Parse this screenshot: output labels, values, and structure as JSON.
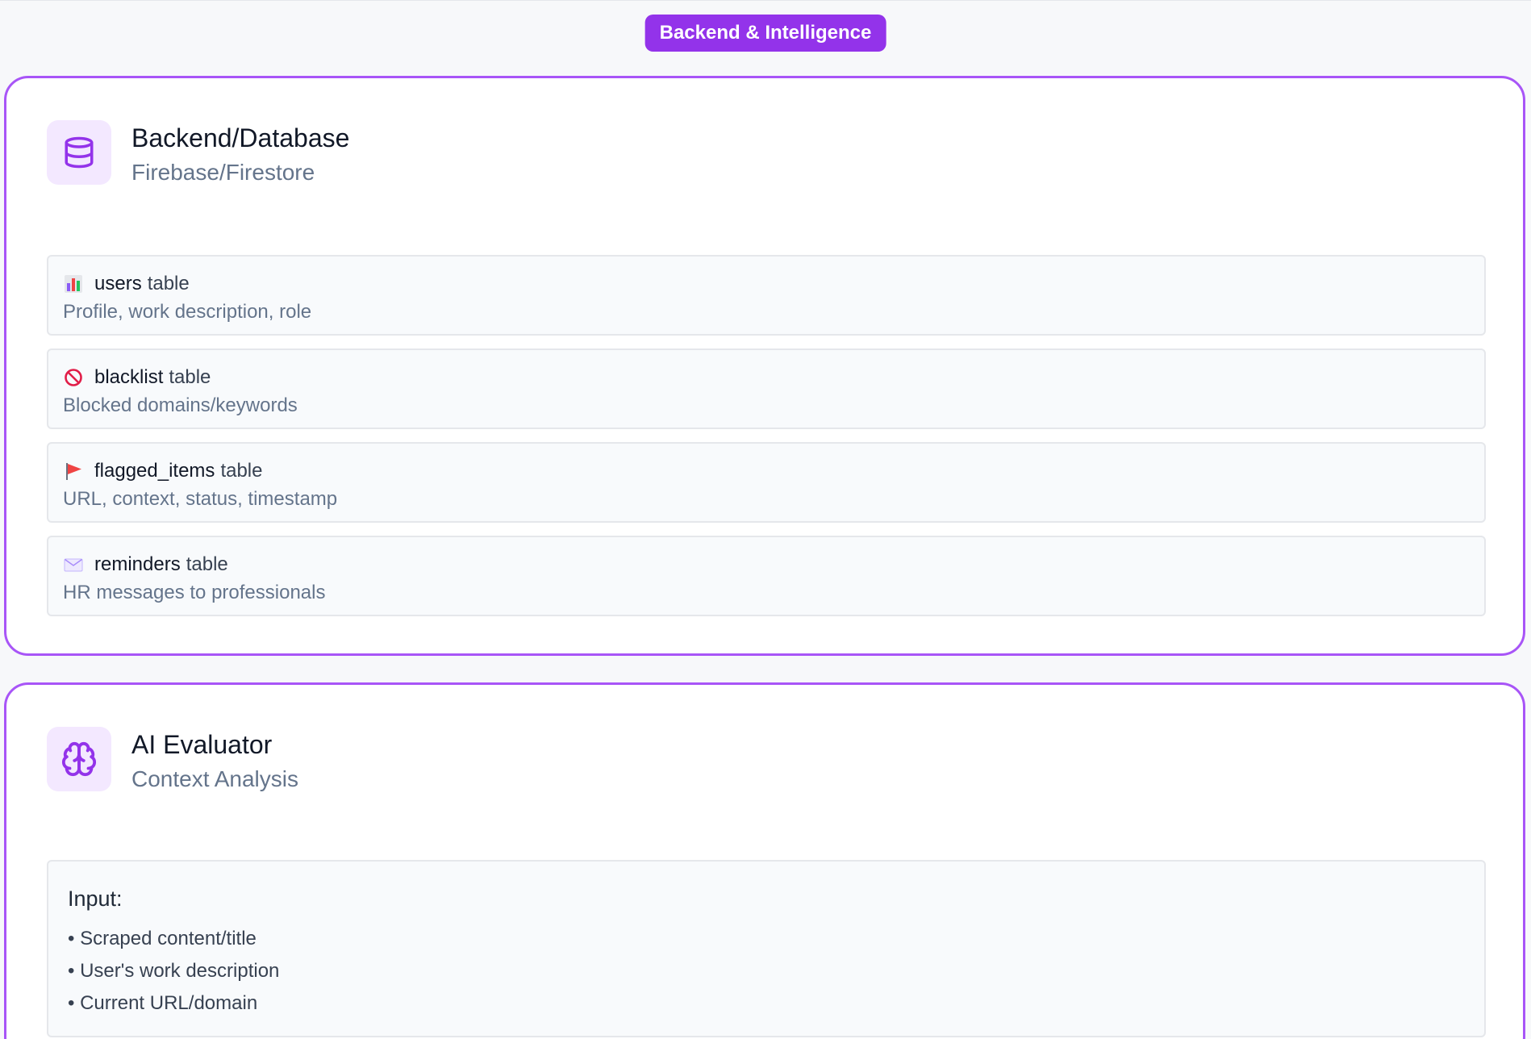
{
  "section_badge": "Backend & Intelligence",
  "colors": {
    "accent": "#9333ea",
    "card_border": "#a855f7",
    "icon_bg": "#f3e8ff",
    "page_bg": "#f7f8fa"
  },
  "backend_card": {
    "title": "Backend/Database",
    "subtitle": "Firebase/Firestore",
    "icon": "database-icon",
    "tables": [
      {
        "icon": "bar-chart-icon",
        "name": "users",
        "suffix": "table",
        "description": "Profile, work description, role"
      },
      {
        "icon": "prohibited-icon",
        "name": "blacklist",
        "suffix": "table",
        "description": "Blocked domains/keywords"
      },
      {
        "icon": "flag-icon",
        "name": "flagged_items",
        "suffix": "table",
        "description": "URL, context, status, timestamp"
      },
      {
        "icon": "envelope-icon",
        "name": "reminders",
        "suffix": "table",
        "description": "HR messages to professionals"
      }
    ]
  },
  "ai_card": {
    "title": "AI Evaluator",
    "subtitle": "Context Analysis",
    "icon": "brain-icon",
    "input": {
      "title": "Input:",
      "items": [
        "• Scraped content/title",
        "• User's work description",
        "• Current URL/domain"
      ]
    }
  }
}
